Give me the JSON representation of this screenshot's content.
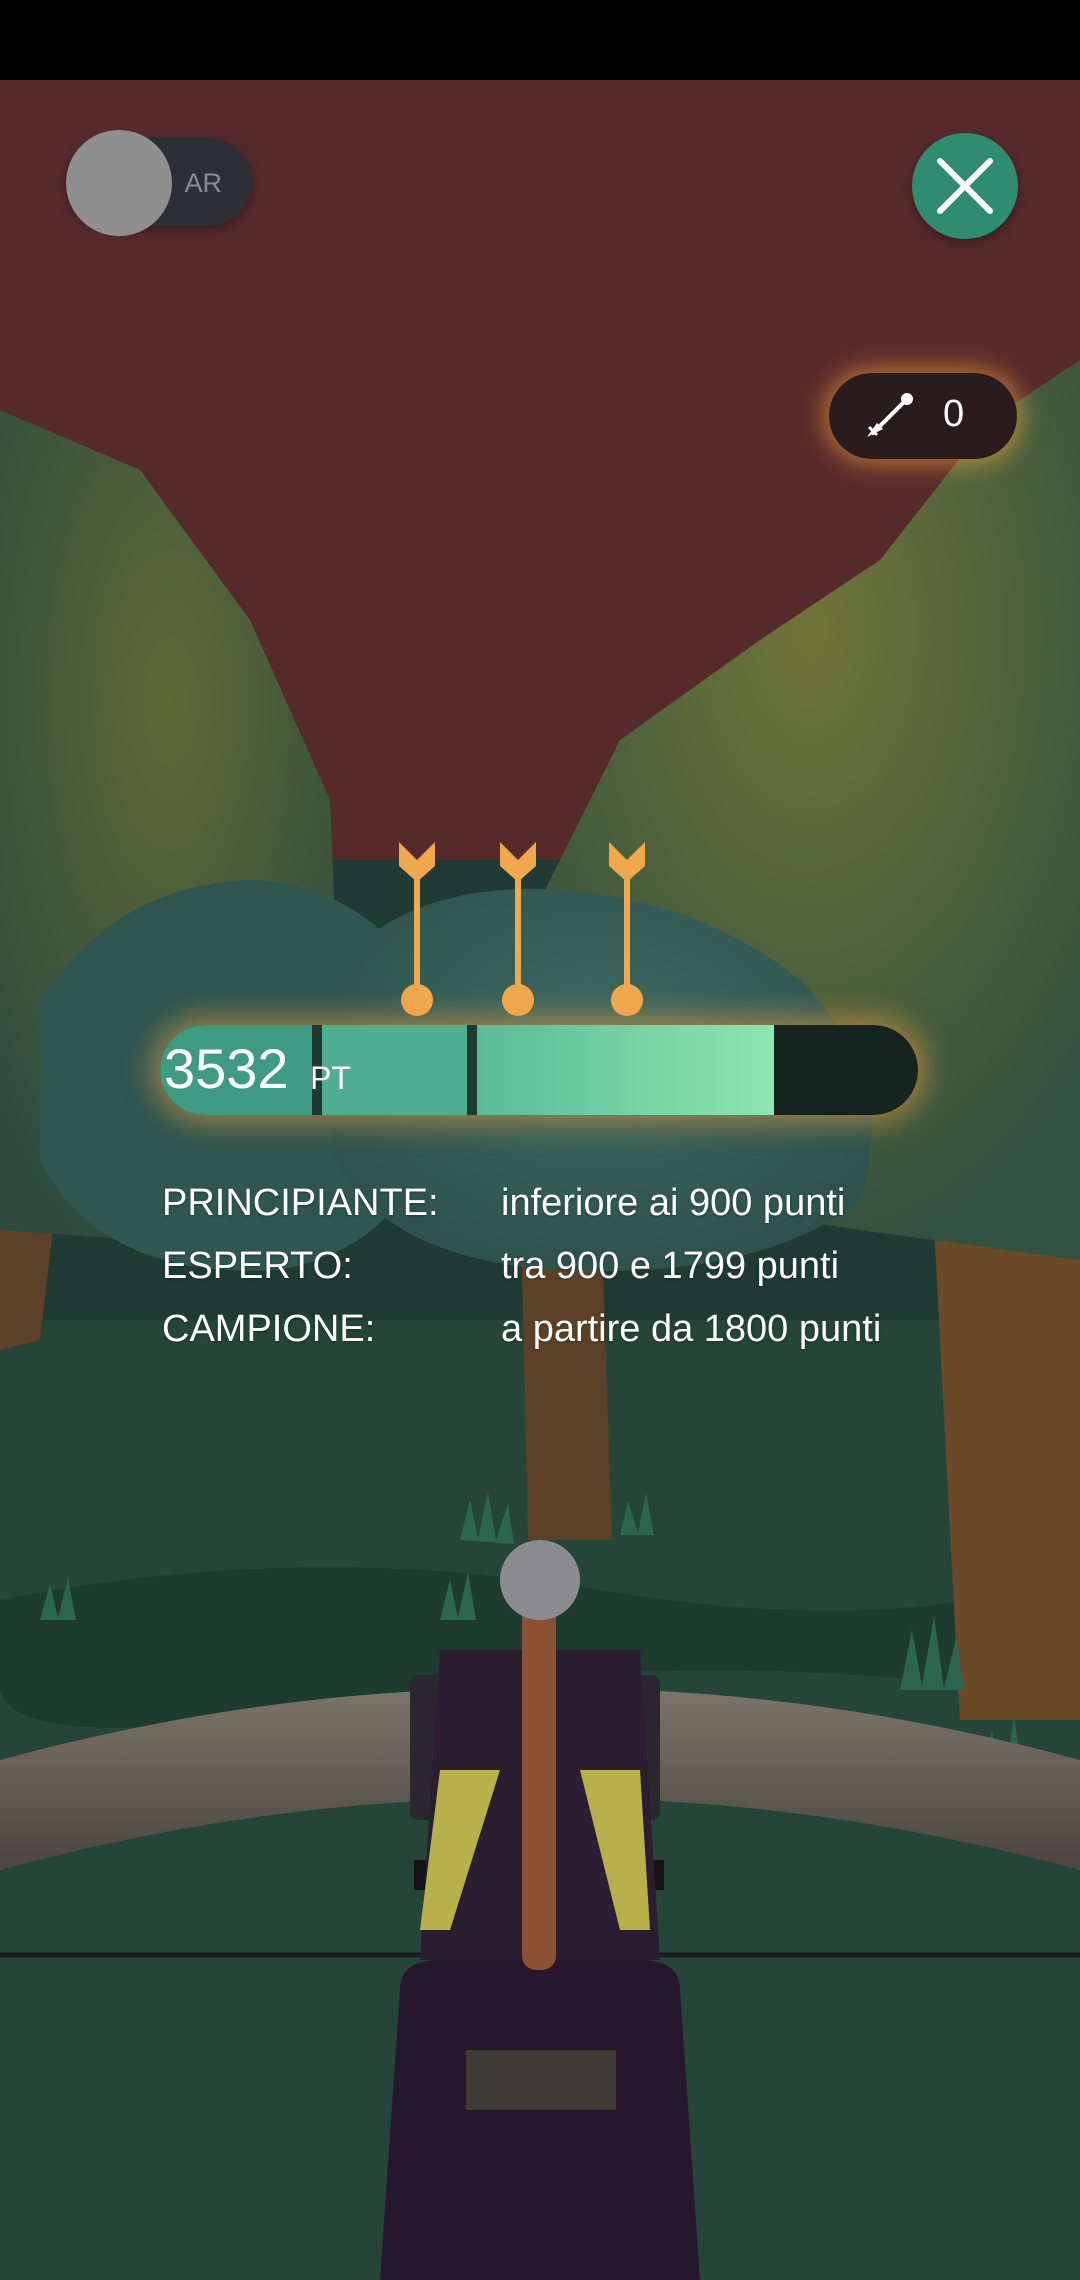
{
  "ar_toggle": {
    "label": "AR",
    "on": false
  },
  "close_button": {
    "icon": "close-icon"
  },
  "arrow_counter": {
    "icon": "arrow-icon",
    "count": "0"
  },
  "arrows_remaining": {
    "count": 3,
    "icon": "arrow-icon",
    "color": "#f0a84e"
  },
  "score": {
    "value": "3532",
    "unit": "PT",
    "fill": 0.81
  },
  "levels": [
    {
      "name": "PRINCIPIANTE:",
      "desc": "inferiore ai 900 punti"
    },
    {
      "name": "ESPERTO:",
      "desc": "tra 900 e 1799 punti"
    },
    {
      "name": "CAMPIONE:",
      "desc": "a partire da 1800 punti"
    }
  ],
  "colors": {
    "accent": "#2f8c71",
    "sky": "#562a2b",
    "ground": "#244538",
    "glow": "#f8a83c"
  }
}
